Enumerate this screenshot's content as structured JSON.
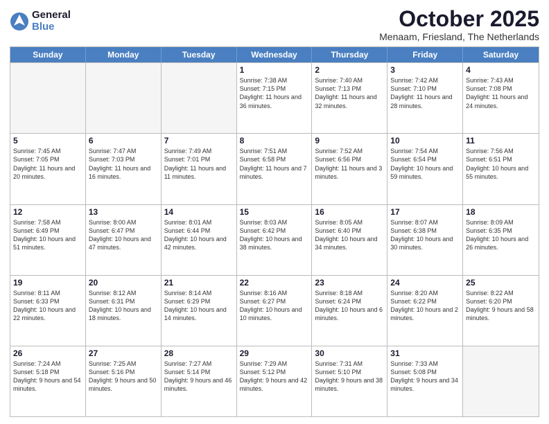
{
  "logo": {
    "general": "General",
    "blue": "Blue"
  },
  "title": "October 2025",
  "location": "Menaam, Friesland, The Netherlands",
  "days": [
    "Sunday",
    "Monday",
    "Tuesday",
    "Wednesday",
    "Thursday",
    "Friday",
    "Saturday"
  ],
  "weeks": [
    [
      {
        "day": "",
        "info": ""
      },
      {
        "day": "",
        "info": ""
      },
      {
        "day": "",
        "info": ""
      },
      {
        "day": "1",
        "info": "Sunrise: 7:38 AM\nSunset: 7:15 PM\nDaylight: 11 hours and 36 minutes."
      },
      {
        "day": "2",
        "info": "Sunrise: 7:40 AM\nSunset: 7:13 PM\nDaylight: 11 hours and 32 minutes."
      },
      {
        "day": "3",
        "info": "Sunrise: 7:42 AM\nSunset: 7:10 PM\nDaylight: 11 hours and 28 minutes."
      },
      {
        "day": "4",
        "info": "Sunrise: 7:43 AM\nSunset: 7:08 PM\nDaylight: 11 hours and 24 minutes."
      }
    ],
    [
      {
        "day": "5",
        "info": "Sunrise: 7:45 AM\nSunset: 7:05 PM\nDaylight: 11 hours and 20 minutes."
      },
      {
        "day": "6",
        "info": "Sunrise: 7:47 AM\nSunset: 7:03 PM\nDaylight: 11 hours and 16 minutes."
      },
      {
        "day": "7",
        "info": "Sunrise: 7:49 AM\nSunset: 7:01 PM\nDaylight: 11 hours and 11 minutes."
      },
      {
        "day": "8",
        "info": "Sunrise: 7:51 AM\nSunset: 6:58 PM\nDaylight: 11 hours and 7 minutes."
      },
      {
        "day": "9",
        "info": "Sunrise: 7:52 AM\nSunset: 6:56 PM\nDaylight: 11 hours and 3 minutes."
      },
      {
        "day": "10",
        "info": "Sunrise: 7:54 AM\nSunset: 6:54 PM\nDaylight: 10 hours and 59 minutes."
      },
      {
        "day": "11",
        "info": "Sunrise: 7:56 AM\nSunset: 6:51 PM\nDaylight: 10 hours and 55 minutes."
      }
    ],
    [
      {
        "day": "12",
        "info": "Sunrise: 7:58 AM\nSunset: 6:49 PM\nDaylight: 10 hours and 51 minutes."
      },
      {
        "day": "13",
        "info": "Sunrise: 8:00 AM\nSunset: 6:47 PM\nDaylight: 10 hours and 47 minutes."
      },
      {
        "day": "14",
        "info": "Sunrise: 8:01 AM\nSunset: 6:44 PM\nDaylight: 10 hours and 42 minutes."
      },
      {
        "day": "15",
        "info": "Sunrise: 8:03 AM\nSunset: 6:42 PM\nDaylight: 10 hours and 38 minutes."
      },
      {
        "day": "16",
        "info": "Sunrise: 8:05 AM\nSunset: 6:40 PM\nDaylight: 10 hours and 34 minutes."
      },
      {
        "day": "17",
        "info": "Sunrise: 8:07 AM\nSunset: 6:38 PM\nDaylight: 10 hours and 30 minutes."
      },
      {
        "day": "18",
        "info": "Sunrise: 8:09 AM\nSunset: 6:35 PM\nDaylight: 10 hours and 26 minutes."
      }
    ],
    [
      {
        "day": "19",
        "info": "Sunrise: 8:11 AM\nSunset: 6:33 PM\nDaylight: 10 hours and 22 minutes."
      },
      {
        "day": "20",
        "info": "Sunrise: 8:12 AM\nSunset: 6:31 PM\nDaylight: 10 hours and 18 minutes."
      },
      {
        "day": "21",
        "info": "Sunrise: 8:14 AM\nSunset: 6:29 PM\nDaylight: 10 hours and 14 minutes."
      },
      {
        "day": "22",
        "info": "Sunrise: 8:16 AM\nSunset: 6:27 PM\nDaylight: 10 hours and 10 minutes."
      },
      {
        "day": "23",
        "info": "Sunrise: 8:18 AM\nSunset: 6:24 PM\nDaylight: 10 hours and 6 minutes."
      },
      {
        "day": "24",
        "info": "Sunrise: 8:20 AM\nSunset: 6:22 PM\nDaylight: 10 hours and 2 minutes."
      },
      {
        "day": "25",
        "info": "Sunrise: 8:22 AM\nSunset: 6:20 PM\nDaylight: 9 hours and 58 minutes."
      }
    ],
    [
      {
        "day": "26",
        "info": "Sunrise: 7:24 AM\nSunset: 5:18 PM\nDaylight: 9 hours and 54 minutes."
      },
      {
        "day": "27",
        "info": "Sunrise: 7:25 AM\nSunset: 5:16 PM\nDaylight: 9 hours and 50 minutes."
      },
      {
        "day": "28",
        "info": "Sunrise: 7:27 AM\nSunset: 5:14 PM\nDaylight: 9 hours and 46 minutes."
      },
      {
        "day": "29",
        "info": "Sunrise: 7:29 AM\nSunset: 5:12 PM\nDaylight: 9 hours and 42 minutes."
      },
      {
        "day": "30",
        "info": "Sunrise: 7:31 AM\nSunset: 5:10 PM\nDaylight: 9 hours and 38 minutes."
      },
      {
        "day": "31",
        "info": "Sunrise: 7:33 AM\nSunset: 5:08 PM\nDaylight: 9 hours and 34 minutes."
      },
      {
        "day": "",
        "info": ""
      }
    ]
  ]
}
